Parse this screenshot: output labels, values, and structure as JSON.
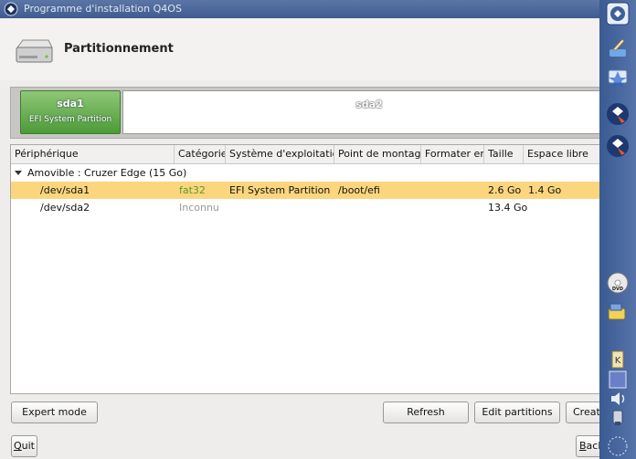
{
  "window": {
    "title": "Programme d'installation Q4OS"
  },
  "header": {
    "title": "Partitionnement"
  },
  "partition_bar": {
    "segments": [
      {
        "name": "sda1",
        "desc": "EFI System Partition"
      },
      {
        "name": "sda2"
      }
    ]
  },
  "table": {
    "columns": [
      "Périphérique",
      "Catégorie",
      "Système d'exploitation",
      "Point de montage",
      "Formater en",
      "Taille",
      "Espace libre"
    ],
    "device": {
      "label": "Amovible : Cruzer Edge (15 Go)"
    },
    "rows": [
      {
        "device": "/dev/sda1",
        "category": "fat32",
        "os": "EFI System Partition",
        "mount": "/boot/efi",
        "format": "",
        "size": "2.6 Go",
        "free": "1.4 Go"
      },
      {
        "device": "/dev/sda2",
        "category": "Inconnu",
        "os": "",
        "mount": "",
        "format": "",
        "size": "13.4 Go",
        "free": ""
      }
    ]
  },
  "buttons": {
    "expert": "Expert mode",
    "refresh": "Refresh",
    "edit": "Edit partitions",
    "create": "Create",
    "quit_underline": "Q",
    "quit_rest": "uit",
    "back_underline": "B",
    "back_rest": "ack"
  },
  "colors": {
    "selection": "#fbd67e",
    "panel": "#4a6aa2"
  }
}
